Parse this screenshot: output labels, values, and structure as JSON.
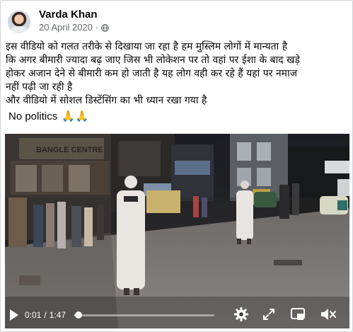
{
  "post": {
    "author": "Varda Khan",
    "date": "20 April 2020",
    "separator": "·",
    "privacy_icon": "globe-icon",
    "text_lines": [
      "इस वीडियो को गलत तरीके से दिखाया जा रहा है हम मुस्लिम लोगों में मान्यता है",
      "कि अगर बीमारी ज्यादा बढ़ जाए जिस भी लोकेशन पर तो वहां पर ईशा के बाद खड़े",
      "होकर अजान देने से बीमारी कम हो जाती है यह लोग वही कर रहे हैं यहां पर नमाज",
      "नहीं पढ़ी जा रही है",
      "और वीडियो में सोशल डिस्टेंसिंग का भी ध्यान रखा गया है"
    ],
    "tagline": "No politics",
    "emoji": "🙏🙏"
  },
  "video": {
    "current_time": "0:01",
    "time_separator": "/",
    "duration": "1:47",
    "progress_fraction": 0.03,
    "shop_sign_1": "BANGLE CENTRE",
    "icons": [
      "play-icon",
      "settings-gear-icon",
      "fullscreen-expand-icon",
      "picture-in-picture-icon",
      "volume-muted-icon"
    ]
  },
  "colors": {
    "text": "#050505",
    "secondary": "#65676b",
    "emoji_gold": "#f2b531"
  }
}
